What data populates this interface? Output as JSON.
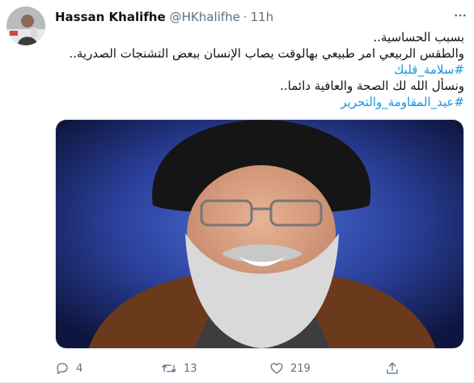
{
  "author": {
    "name": "Hassan Khalifhe",
    "handle": "@HKhalifhe",
    "separator": "·",
    "time": "11h"
  },
  "tweet": {
    "lines": [
      "بسبب الحساسية..",
      "والطقس الربيعي امر طبيعي بهالوقت يصاب الإنسان ببعض التشنجات الصدرية..",
      "#سلامة_قلبك",
      "ونسأل الله لك الصحة والعافية دائما..",
      "#عيد_المقاومة_والتحرير"
    ]
  },
  "actions": {
    "reply_count": "4",
    "retweet_count": "13",
    "like_count": "219"
  },
  "colors": {
    "link": "#1b95e0",
    "secondary_text": "#5b7083",
    "icon": "#5b7083"
  },
  "icons": {
    "reply": "reply-icon",
    "retweet": "retweet-icon",
    "like": "heart-icon",
    "share": "share-icon",
    "more": "more-icon"
  }
}
